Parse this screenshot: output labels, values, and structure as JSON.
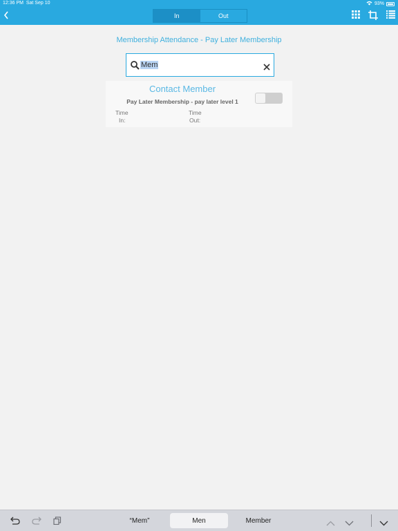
{
  "status": {
    "time": "12:36 PM",
    "date": "Sat Sep 10",
    "battery": "93%"
  },
  "nav": {
    "tabs": [
      {
        "label": "In",
        "active": true
      },
      {
        "label": "Out",
        "active": false
      }
    ]
  },
  "page": {
    "title": "Membership Attendance - Pay Later Membership"
  },
  "search": {
    "value": "Mem"
  },
  "card": {
    "name": "Contact Member",
    "plan": "Pay Later Membership - pay later level 1",
    "time_in_label_1": "Time",
    "time_in_label_2": "In:",
    "time_out_label_1": "Time",
    "time_out_label_2": "Out:",
    "checked_in": false
  },
  "keyboard": {
    "suggestions": [
      "“Mem”",
      "Men",
      "Member"
    ]
  },
  "colors": {
    "accent": "#29a9e0",
    "title": "#3fb0de",
    "background": "#f2f2f2"
  }
}
